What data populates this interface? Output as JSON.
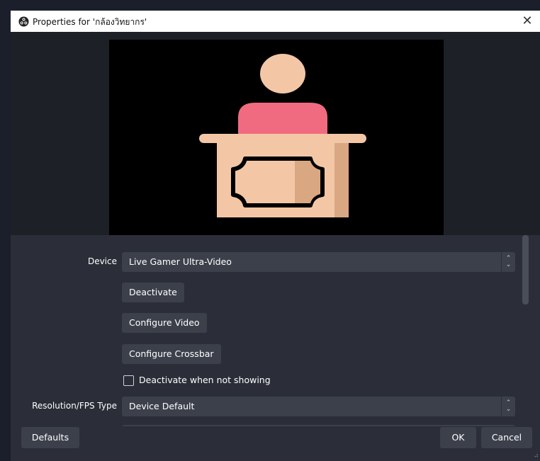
{
  "window": {
    "title": "Properties for 'กล้องวิทยากร'",
    "close_glyph": "✕"
  },
  "colors": {
    "background": "#1b1f2b",
    "panel": "#2b2e38",
    "control": "#3c404b",
    "titlebar": "#ffffff",
    "preview_bg": "#000000"
  },
  "preview": {
    "description_icon": "speaker-at-podium-icon"
  },
  "properties": {
    "device": {
      "label": "Device",
      "value": "Live Gamer Ultra-Video"
    },
    "deactivate_label": "Deactivate",
    "configure_video_label": "Configure Video",
    "configure_crossbar_label": "Configure Crossbar",
    "deactivate_when_not_showing": {
      "label": "Deactivate when not showing",
      "checked": false
    },
    "resolution_fps_type": {
      "label": "Resolution/FPS Type",
      "value": "Device Default"
    }
  },
  "footer": {
    "defaults_label": "Defaults",
    "ok_label": "OK",
    "cancel_label": "Cancel"
  }
}
